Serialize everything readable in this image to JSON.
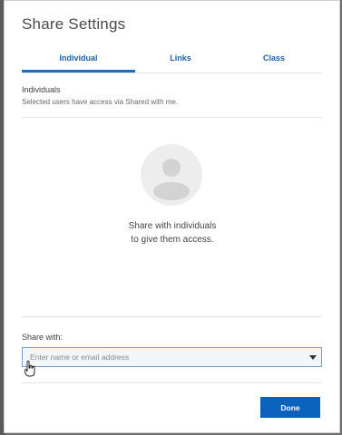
{
  "dialog": {
    "title": "Share Settings",
    "tabs": [
      {
        "label": "Individual",
        "active": true
      },
      {
        "label": "Links",
        "active": false
      },
      {
        "label": "Class",
        "active": false
      }
    ],
    "section": {
      "title": "Individuals",
      "description": "Selected users have access via Shared with me."
    },
    "empty_state": {
      "icon": "user-avatar-icon",
      "line1": "Share with individuals",
      "line2": "to give them access."
    },
    "share_with": {
      "label": "Share with:",
      "placeholder": "Enter name or email address"
    },
    "done_label": "Done"
  },
  "colors": {
    "accent": "#1a6fc4",
    "button": "#0a62bd",
    "tab_text": "#1f5fa8"
  }
}
